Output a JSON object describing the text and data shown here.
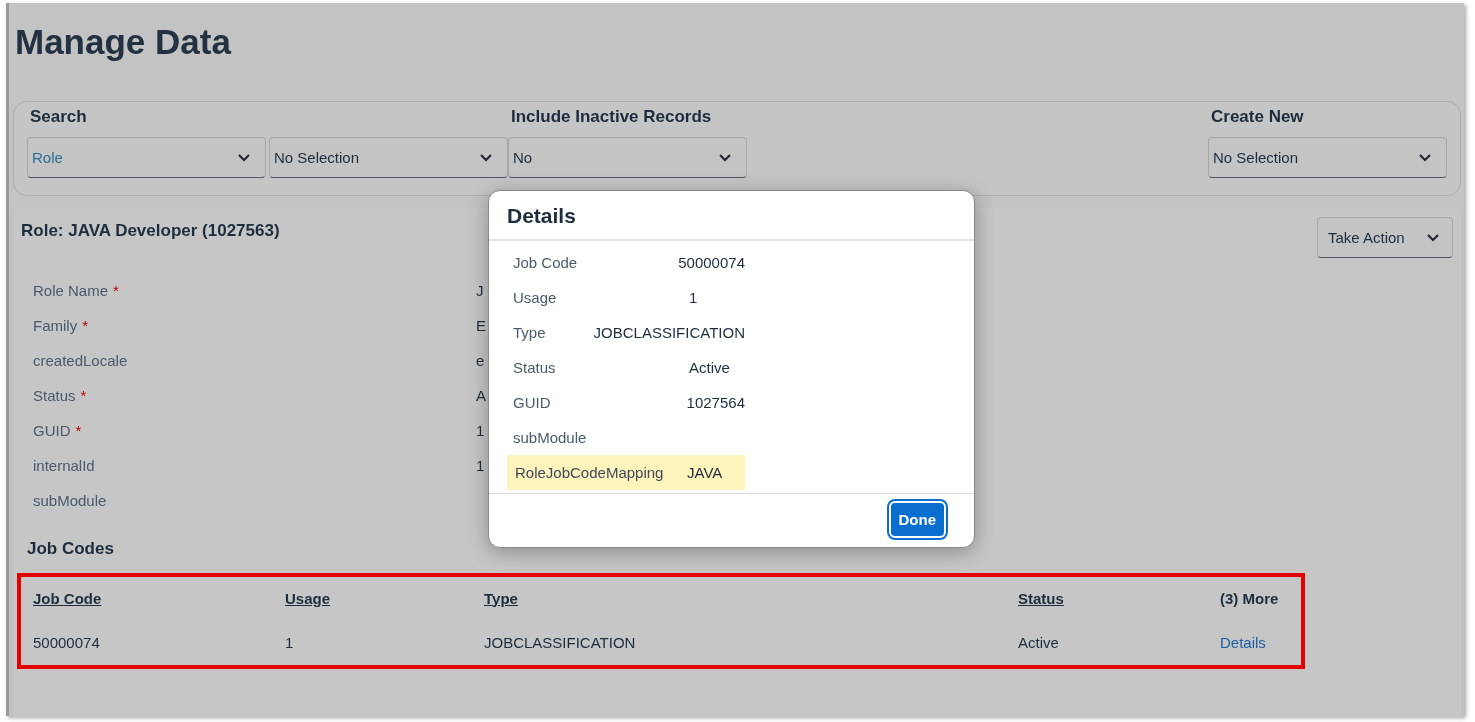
{
  "page": {
    "title": "Manage Data"
  },
  "filters": [
    {
      "label": "Search",
      "selects": [
        {
          "value": "Role",
          "emphasized": true
        },
        {
          "value": "No Selection",
          "emphasized": false
        }
      ]
    },
    {
      "label": "Include Inactive Records",
      "selects": [
        {
          "value": "No",
          "emphasized": false
        }
      ]
    },
    {
      "label": "Create New",
      "selects": [
        {
          "value": "No Selection",
          "emphasized": false
        }
      ]
    }
  ],
  "record": {
    "title": "Role: JAVA Developer (1027563)",
    "action_button": "Take Action",
    "fields": [
      {
        "label": "Role Name",
        "required_mark": "*",
        "value": "J"
      },
      {
        "label": "Family",
        "required_mark": "*",
        "value": "E"
      },
      {
        "label": "createdLocale",
        "value": "e"
      },
      {
        "label": "Status",
        "required_mark": "*",
        "value": "A"
      },
      {
        "label": "GUID",
        "required_mark": "*",
        "value": "1"
      },
      {
        "label": "internalId",
        "value": "1"
      },
      {
        "label": "subModule"
      }
    ]
  },
  "job_codes": {
    "title": "Job Codes",
    "columns": [
      {
        "label": "Job Code",
        "kind": "sortable"
      },
      {
        "label": "Usage",
        "kind": "sortable"
      },
      {
        "label": "Type",
        "kind": "sortable"
      },
      {
        "label": "Status",
        "kind": "sortable"
      },
      {
        "label": "(3) More",
        "kind": "action"
      }
    ],
    "rows": [
      [
        "50000074",
        "1",
        "JOBCLASSIFICATION",
        "Active",
        "Details"
      ]
    ]
  },
  "dialog": {
    "title": "Details",
    "fields": [
      {
        "label": "Job Code",
        "value": "50000074",
        "highlighted": false
      },
      {
        "label": "Usage",
        "value": "1",
        "highlighted": false
      },
      {
        "label": "Type",
        "value": "JOBCLASSIFICATION",
        "highlighted": false
      },
      {
        "label": "Status",
        "value": "Active",
        "highlighted": false
      },
      {
        "label": "GUID",
        "value": "1027564",
        "highlighted": false
      },
      {
        "label": "subModule",
        "highlighted": false
      },
      {
        "label": "RoleJobCodeMapping",
        "value": "JAVA",
        "highlighted": true
      }
    ],
    "button": "Done"
  }
}
